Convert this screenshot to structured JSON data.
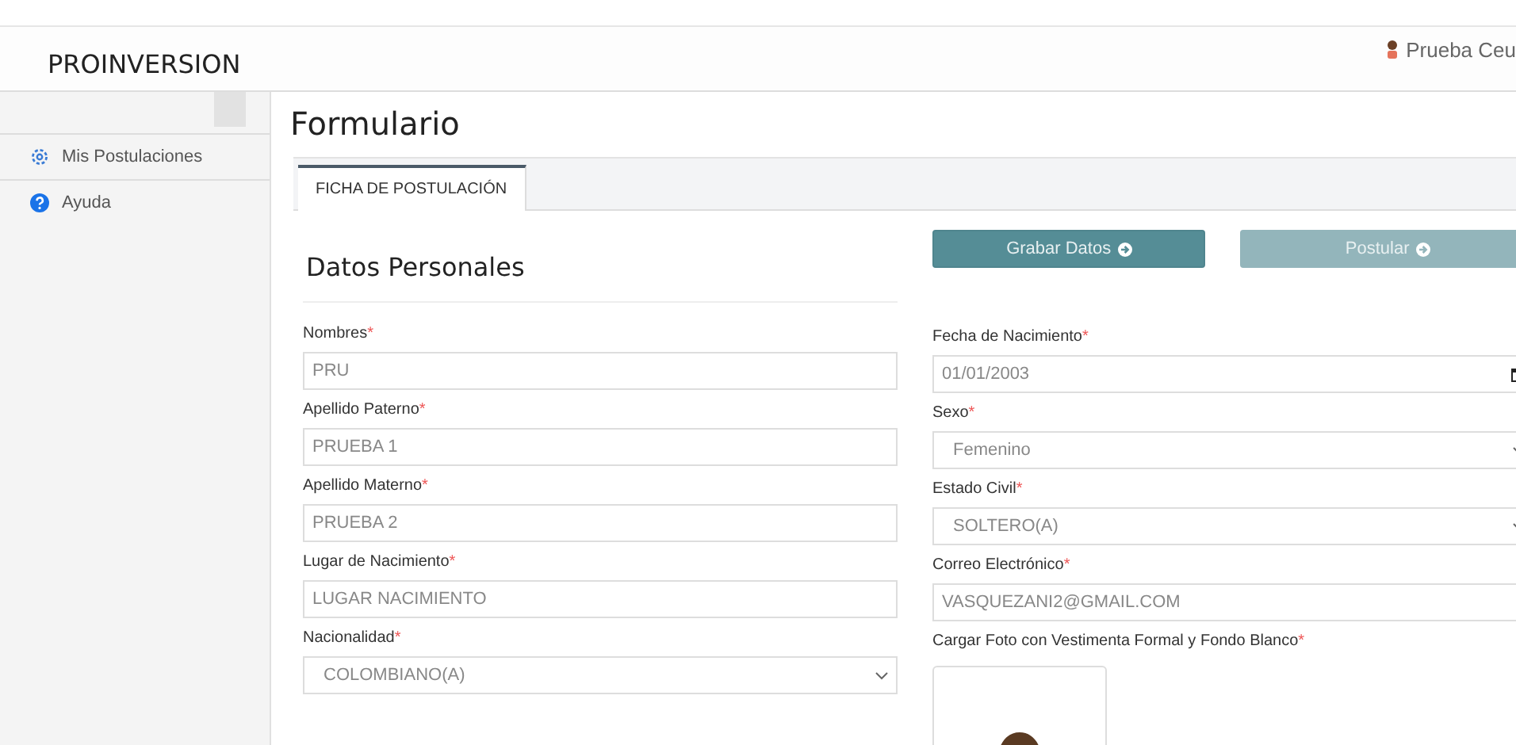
{
  "header": {
    "brand": "PROINVERSION",
    "user": "Prueba Ceu"
  },
  "sidebar": {
    "items": [
      {
        "label": "Mis Postulaciones",
        "kind": "settings"
      },
      {
        "label": "Ayuda",
        "kind": "help"
      }
    ]
  },
  "page_title": "Formulario",
  "tabs": [
    {
      "label": "FICHA DE POSTULACIÓN",
      "selected": true
    }
  ],
  "section_title": "Datos Personales",
  "buttons": [
    {
      "label": "Grabar Datos",
      "disabled": false
    },
    {
      "label": "Postular",
      "disabled": true
    }
  ],
  "left_fields": [
    {
      "kind": "text",
      "label": "Nombres",
      "required_mark": "*",
      "value": "PRU"
    },
    {
      "kind": "text",
      "label": "Apellido Paterno",
      "required_mark": "*",
      "value": "PRUEBA 1"
    },
    {
      "kind": "text",
      "label": "Apellido Materno",
      "required_mark": "*",
      "value": "PRUEBA 2"
    },
    {
      "kind": "text",
      "label": "Lugar de Nacimiento",
      "required_mark": "*",
      "value": "LUGAR NACIMIENTO"
    },
    {
      "kind": "select",
      "label": "Nacionalidad",
      "required_mark": "*",
      "value": "COLOMBIANO(A)"
    }
  ],
  "right_fields": [
    {
      "kind": "date",
      "label": "Fecha de Nacimiento",
      "required_mark": "*",
      "value": "01/01/2003"
    },
    {
      "kind": "select",
      "label": "Sexo",
      "required_mark": "*",
      "value": "Femenino"
    },
    {
      "kind": "select",
      "label": "Estado Civil",
      "required_mark": "*",
      "value": "SOLTERO(A)"
    },
    {
      "kind": "text",
      "label": "Correo Electrónico",
      "required_mark": "*",
      "value": "VASQUEZANI2@GMAIL.COM"
    },
    {
      "kind": "photo",
      "label": "Cargar Foto con Vestimenta Formal y Fondo Blanco",
      "required_mark": "*"
    }
  ]
}
